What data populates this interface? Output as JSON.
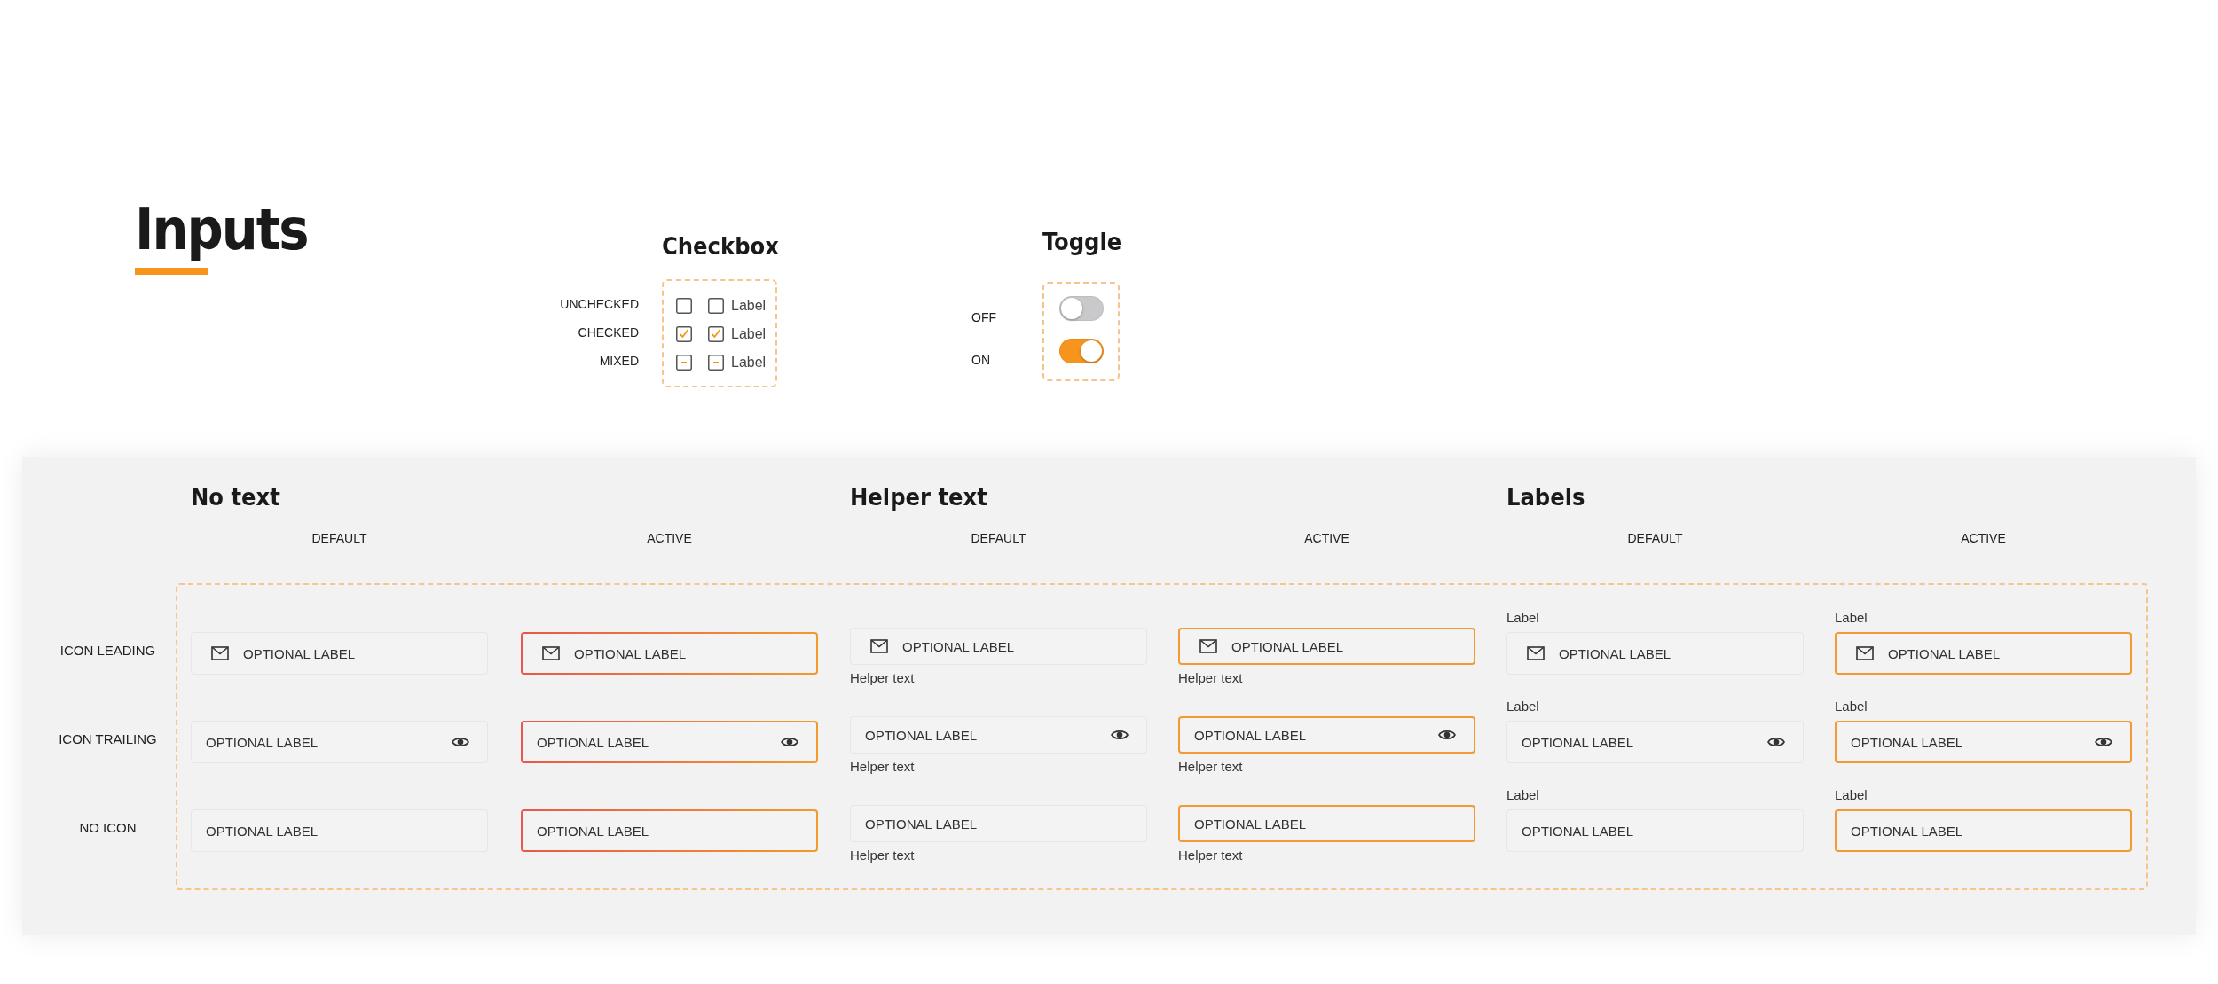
{
  "title": "Inputs",
  "checkbox": {
    "heading": "Checkbox",
    "rows": [
      {
        "state_label": "UNCHECKED",
        "checked": false,
        "mixed": false,
        "label": "Label"
      },
      {
        "state_label": "CHECKED",
        "checked": true,
        "mixed": false,
        "label": "Label"
      },
      {
        "state_label": "MIXED",
        "checked": false,
        "mixed": true,
        "label": "Label"
      }
    ]
  },
  "toggle": {
    "heading": "Toggle",
    "rows": [
      {
        "state_label": "OFF",
        "on": false
      },
      {
        "state_label": "ON",
        "on": true
      }
    ]
  },
  "inputs": {
    "row_labels": [
      "ICON LEADING",
      "ICON TRAILING",
      "NO ICON"
    ],
    "sections": [
      {
        "heading": "No text",
        "kind": "basic",
        "columns": [
          {
            "header": "DEFAULT",
            "active": false,
            "fields": [
              {
                "kind": "leading",
                "placeholder": "OPTIONAL LABEL"
              },
              {
                "kind": "trailing",
                "placeholder": "OPTIONAL LABEL"
              },
              {
                "kind": "plain",
                "placeholder": "OPTIONAL LABEL"
              }
            ]
          },
          {
            "header": "ACTIVE",
            "active": true,
            "fields": [
              {
                "kind": "leading",
                "placeholder": "OPTIONAL LABEL"
              },
              {
                "kind": "trailing",
                "placeholder": "OPTIONAL LABEL"
              },
              {
                "kind": "plain",
                "placeholder": "OPTIONAL LABEL"
              }
            ]
          }
        ]
      },
      {
        "heading": "Helper text",
        "kind": "helper",
        "columns": [
          {
            "header": "DEFAULT",
            "active": false,
            "fields": [
              {
                "kind": "leading",
                "placeholder": "OPTIONAL LABEL",
                "helper": "Helper text"
              },
              {
                "kind": "trailing",
                "placeholder": "OPTIONAL LABEL",
                "helper": "Helper text"
              },
              {
                "kind": "plain",
                "placeholder": "OPTIONAL LABEL",
                "helper": "Helper text"
              }
            ]
          },
          {
            "header": "ACTIVE",
            "active": true,
            "fields": [
              {
                "kind": "leading",
                "placeholder": "OPTIONAL LABEL",
                "helper": "Helper text"
              },
              {
                "kind": "trailing",
                "placeholder": "OPTIONAL LABEL",
                "helper": "Helper text"
              },
              {
                "kind": "plain",
                "placeholder": "OPTIONAL LABEL",
                "helper": "Helper text"
              }
            ]
          }
        ]
      },
      {
        "heading": "Labels",
        "kind": "labeled",
        "columns": [
          {
            "header": "DEFAULT",
            "active": false,
            "fields": [
              {
                "label": "Label",
                "kind": "leading",
                "placeholder": "OPTIONAL LABEL"
              },
              {
                "label": "Label",
                "kind": "trailing",
                "placeholder": "OPTIONAL LABEL"
              },
              {
                "label": "Label",
                "kind": "plain",
                "placeholder": "OPTIONAL LABEL"
              }
            ]
          },
          {
            "header": "ACTIVE",
            "active": true,
            "fields": [
              {
                "label": "Label",
                "kind": "leading",
                "placeholder": "OPTIONAL LABEL"
              },
              {
                "label": "Label",
                "kind": "trailing",
                "placeholder": "OPTIONAL LABEL"
              },
              {
                "label": "Label",
                "kind": "plain",
                "placeholder": "OPTIONAL LABEL"
              }
            ]
          }
        ]
      }
    ]
  }
}
